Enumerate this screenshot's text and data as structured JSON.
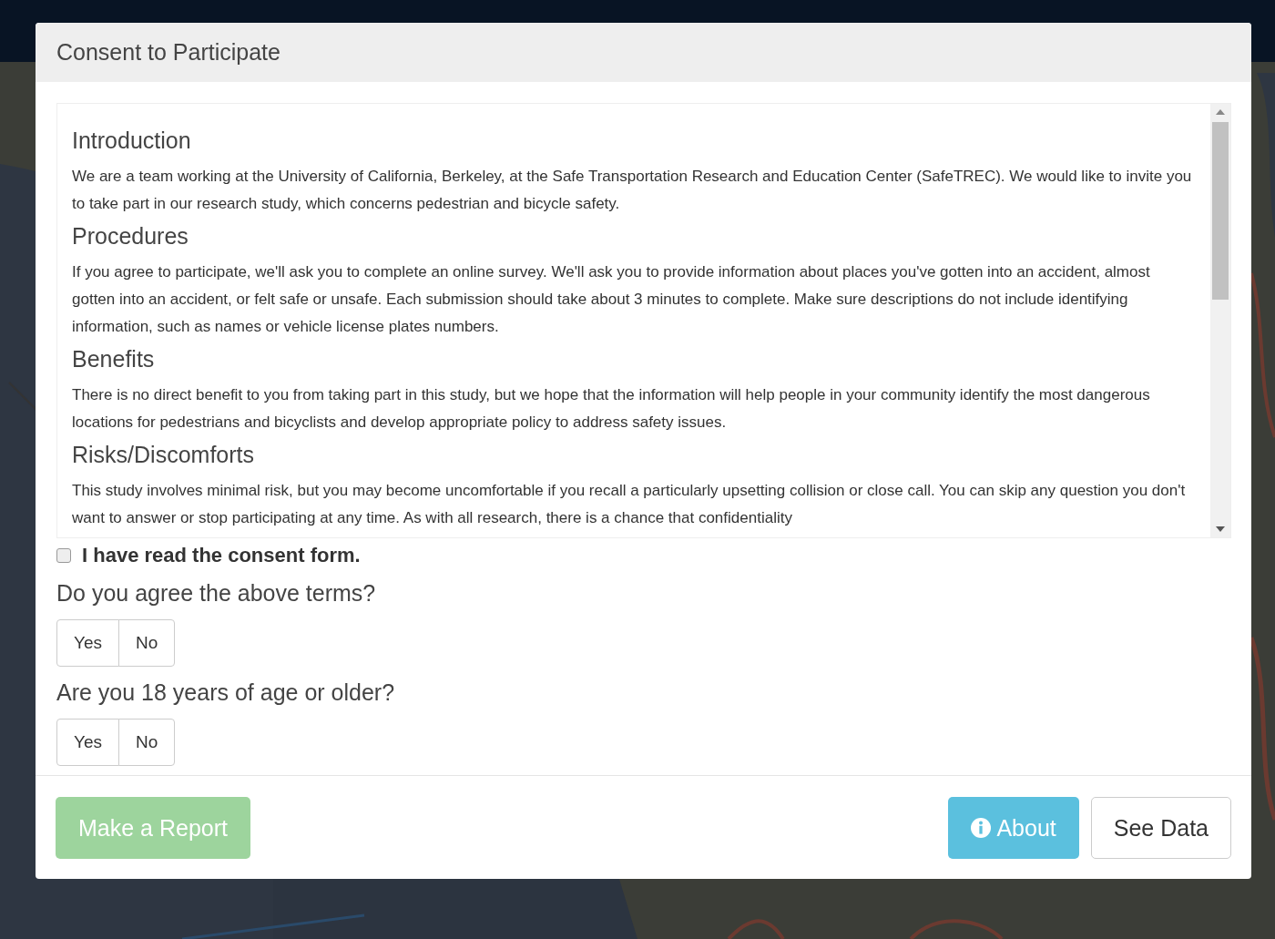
{
  "modal": {
    "title": "Consent to Participate",
    "sections": [
      {
        "heading": "Introduction",
        "text": "We are a team working at the University of California, Berkeley, at the Safe Transportation Research and Education Center (SafeTREC). We would like to invite you to take part in our research study, which concerns pedestrian and bicycle safety."
      },
      {
        "heading": "Procedures",
        "text": "If you agree to participate, we'll ask you to complete an online survey. We'll ask you to provide information about places you've gotten into an accident, almost gotten into an accident, or felt safe or unsafe. Each submission should take about 3 minutes to complete. Make sure descriptions do not include identifying information, such as names or vehicle license plates numbers."
      },
      {
        "heading": "Benefits",
        "text": "There is no direct benefit to you from taking part in this study, but we hope that the information will help people in your community identify the most dangerous locations for pedestrians and bicyclists and develop appropriate policy to address safety issues."
      },
      {
        "heading": "Risks/Discomforts",
        "text": "This study involves minimal risk, but you may become uncomfortable if you recall a particularly upsetting collision or close call. You can skip any question you don't want to answer or stop participating at any time. As with all research, there is a chance that confidentiality"
      }
    ],
    "consent_checkbox": {
      "label": "I have read the consent form.",
      "checked": false
    },
    "questions": [
      {
        "text": "Do you agree the above terms?",
        "options": [
          {
            "label": "Yes",
            "selected": false
          },
          {
            "label": "No",
            "selected": false
          }
        ]
      },
      {
        "text": "Are you 18 years of age or older?",
        "options": [
          {
            "label": "Yes",
            "selected": false
          },
          {
            "label": "No",
            "selected": false
          }
        ]
      }
    ],
    "footer": {
      "make_report": {
        "label": "Make a Report",
        "disabled": true
      },
      "about": {
        "label": "About"
      },
      "see_data": {
        "label": "See Data"
      }
    }
  }
}
